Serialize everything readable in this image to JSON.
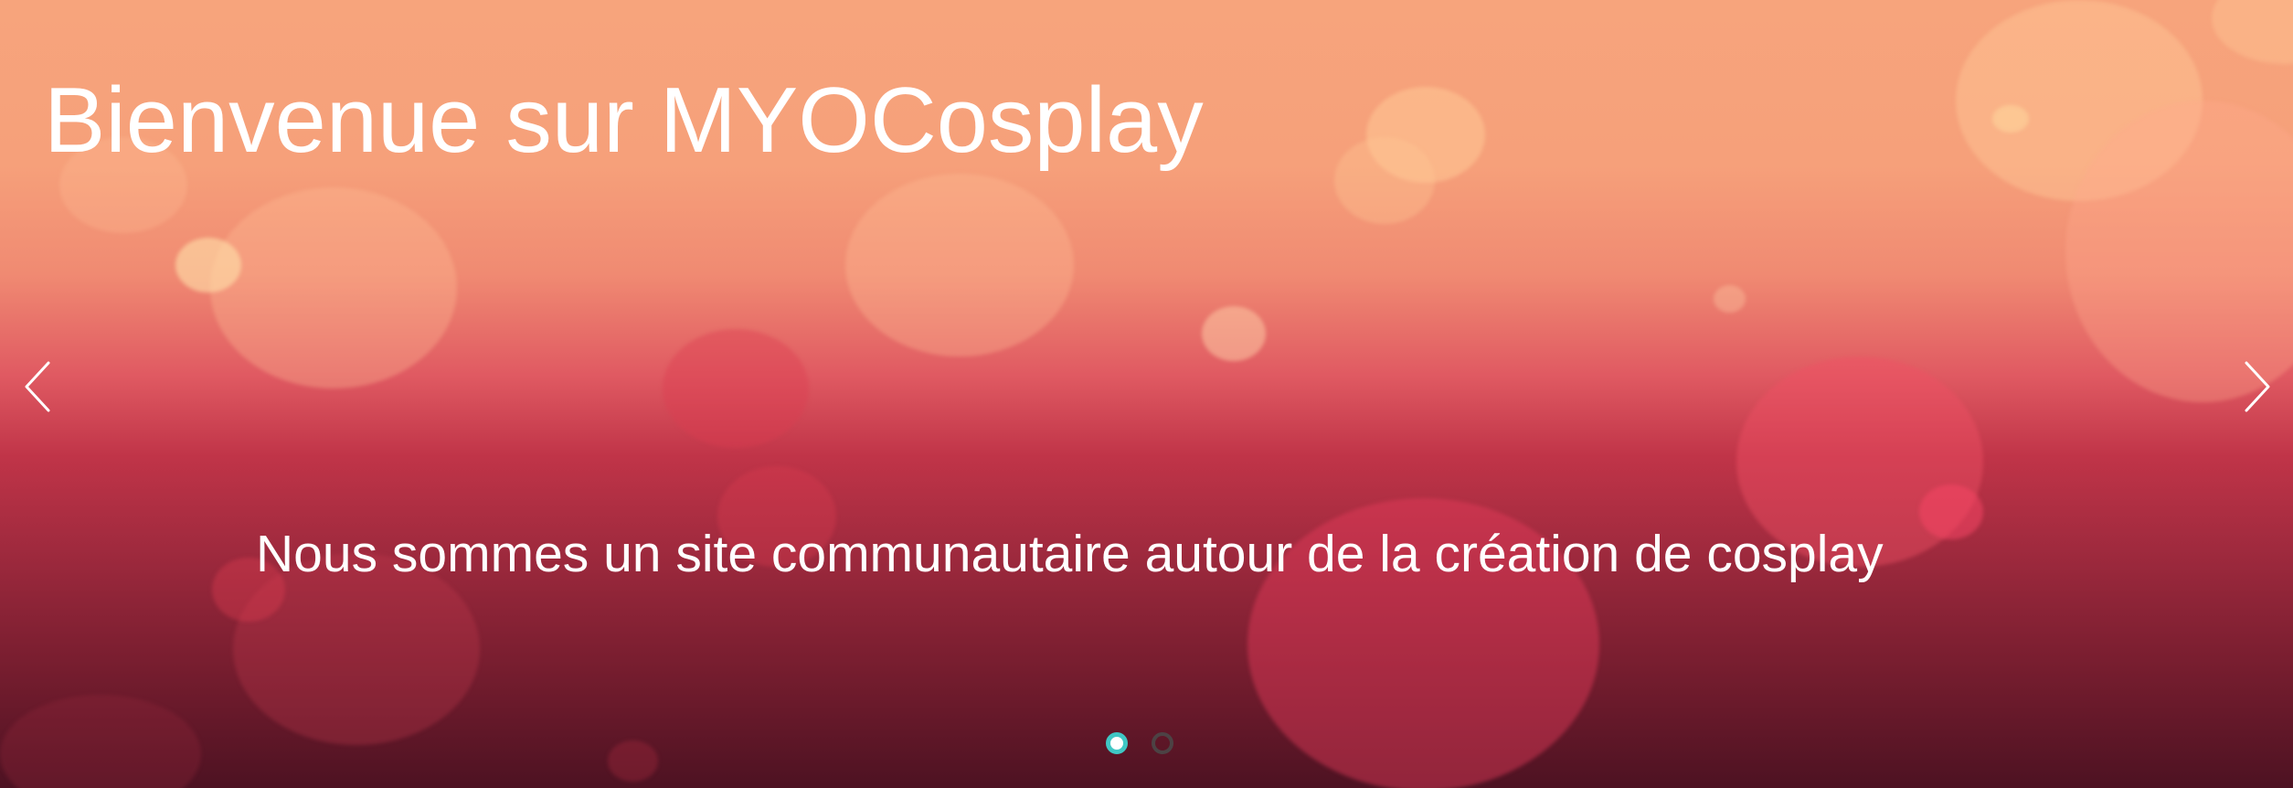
{
  "hero": {
    "title": "Bienvenue sur MYOCosplay",
    "subtitle": "Nous sommes un site communautaire autour de la création de cosplay"
  },
  "carousel": {
    "prev_icon": "chevron-left-icon",
    "next_icon": "chevron-right-icon",
    "slide_count": 2,
    "active_slide": 1,
    "active_dot_color": "#3fc7c4",
    "inactive_dot_color": "#4a4a4a"
  },
  "colors": {
    "gradient_top": "#f7a47c",
    "gradient_mid": "#c03448",
    "gradient_bottom": "#4d1222",
    "text": "#ffffff"
  }
}
